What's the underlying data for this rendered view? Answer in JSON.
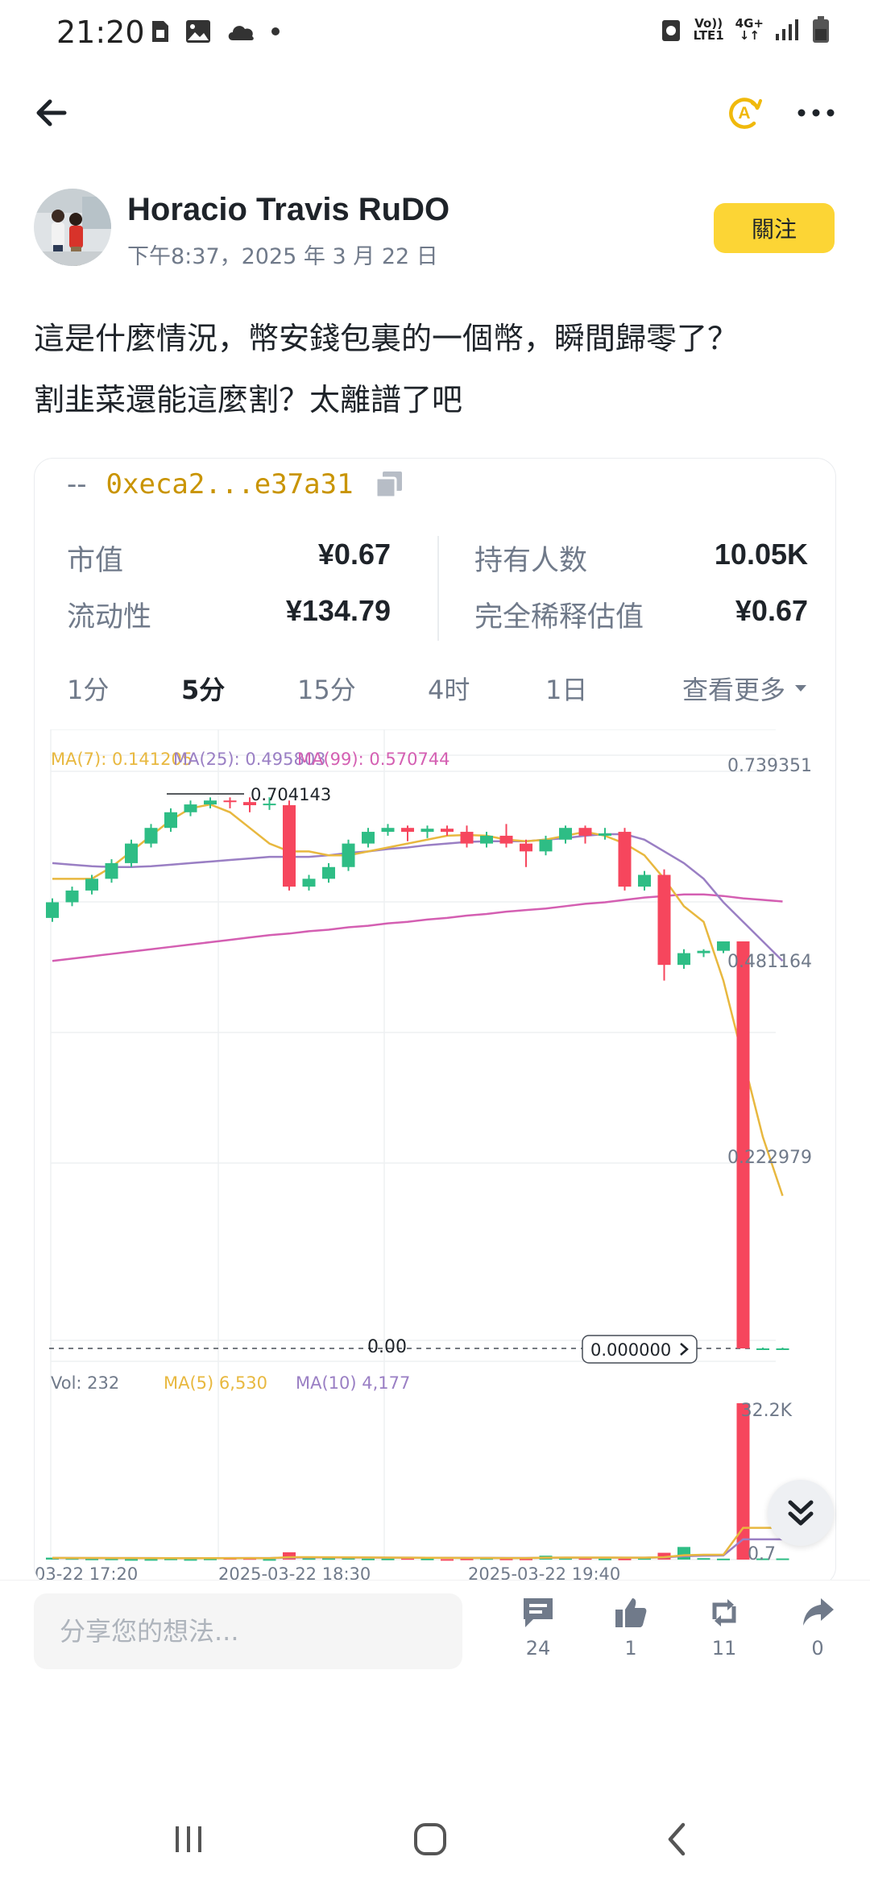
{
  "status": {
    "time": "21:20",
    "net_top": "Vo))",
    "net_bottom": "LTE1",
    "gen_top": "4G+",
    "gen_bottom": "↓↑"
  },
  "post": {
    "author": "Horacio Travis RuDO",
    "time": "下午8:37，2025 年 3 月 22 日",
    "follow_label": "關注",
    "text_line1": "這是什麼情況，幣安錢包裏的一個幣，瞬間歸零了？",
    "text_line2": "割韭菜還能這麼割？太離譜了吧"
  },
  "token": {
    "dash": "--",
    "address": "0xeca2...e37a31",
    "stats": {
      "market_cap_label": "市值",
      "market_cap_value": "¥0.67",
      "liquidity_label": "流动性",
      "liquidity_value": "¥134.79",
      "holders_label": "持有人数",
      "holders_value": "10.05K",
      "fdv_label": "完全稀释估值",
      "fdv_value": "¥0.67"
    },
    "tabs": [
      "1分",
      "5分",
      "15分",
      "4时",
      "1日"
    ],
    "active_tab": "5分",
    "more_label": "查看更多"
  },
  "chart_data": {
    "type": "candlestick",
    "ma_legend": {
      "ma7": "MA(7): 0.141205",
      "ma25": "MA(25): 0.495803",
      "ma99": "MA(99): 0.570744"
    },
    "price_axis_labels": [
      "0.739351",
      "0.481164",
      "0.222979",
      "0.00"
    ],
    "high_marker": "0.704143",
    "current_price": "0.000000",
    "volume_legend": {
      "vol": "Vol: 232",
      "ma5": "MA(5) 6,530",
      "ma10": "MA(10) 4,177"
    },
    "volume_axis_labels": [
      "32.2K",
      "0.7"
    ],
    "time_labels": [
      "03-22 17:20",
      "2025-03-22 18:30",
      "2025-03-22 19:40"
    ],
    "ylim": [
      0,
      0.739351
    ],
    "candles": [
      {
        "o": 0.55,
        "c": 0.57,
        "h": 0.575,
        "l": 0.545
      },
      {
        "o": 0.57,
        "c": 0.585,
        "h": 0.59,
        "l": 0.565
      },
      {
        "o": 0.585,
        "c": 0.6,
        "h": 0.605,
        "l": 0.58
      },
      {
        "o": 0.6,
        "c": 0.62,
        "h": 0.625,
        "l": 0.595
      },
      {
        "o": 0.62,
        "c": 0.645,
        "h": 0.65,
        "l": 0.615
      },
      {
        "o": 0.645,
        "c": 0.665,
        "h": 0.67,
        "l": 0.64
      },
      {
        "o": 0.665,
        "c": 0.685,
        "h": 0.69,
        "l": 0.66
      },
      {
        "o": 0.685,
        "c": 0.695,
        "h": 0.7,
        "l": 0.68
      },
      {
        "o": 0.695,
        "c": 0.7,
        "h": 0.704,
        "l": 0.69
      },
      {
        "o": 0.7,
        "c": 0.698,
        "h": 0.704,
        "l": 0.69
      },
      {
        "o": 0.698,
        "c": 0.694,
        "h": 0.704,
        "l": 0.685
      },
      {
        "o": 0.694,
        "c": 0.696,
        "h": 0.704143,
        "l": 0.688
      },
      {
        "o": 0.694,
        "c": 0.59,
        "h": 0.7,
        "l": 0.585
      },
      {
        "o": 0.59,
        "c": 0.6,
        "h": 0.605,
        "l": 0.585
      },
      {
        "o": 0.6,
        "c": 0.615,
        "h": 0.62,
        "l": 0.595
      },
      {
        "o": 0.615,
        "c": 0.645,
        "h": 0.65,
        "l": 0.61
      },
      {
        "o": 0.645,
        "c": 0.66,
        "h": 0.665,
        "l": 0.64
      },
      {
        "o": 0.66,
        "c": 0.665,
        "h": 0.67,
        "l": 0.655
      },
      {
        "o": 0.665,
        "c": 0.66,
        "h": 0.668,
        "l": 0.648
      },
      {
        "o": 0.66,
        "c": 0.664,
        "h": 0.668,
        "l": 0.652
      },
      {
        "o": 0.664,
        "c": 0.66,
        "h": 0.668,
        "l": 0.655
      },
      {
        "o": 0.66,
        "c": 0.645,
        "h": 0.668,
        "l": 0.64
      },
      {
        "o": 0.645,
        "c": 0.655,
        "h": 0.66,
        "l": 0.64
      },
      {
        "o": 0.655,
        "c": 0.645,
        "h": 0.67,
        "l": 0.64
      },
      {
        "o": 0.645,
        "c": 0.635,
        "h": 0.65,
        "l": 0.615
      },
      {
        "o": 0.635,
        "c": 0.65,
        "h": 0.655,
        "l": 0.63
      },
      {
        "o": 0.65,
        "c": 0.665,
        "h": 0.668,
        "l": 0.645
      },
      {
        "o": 0.665,
        "c": 0.655,
        "h": 0.668,
        "l": 0.645
      },
      {
        "o": 0.655,
        "c": 0.658,
        "h": 0.665,
        "l": 0.65
      },
      {
        "o": 0.66,
        "c": 0.59,
        "h": 0.665,
        "l": 0.585
      },
      {
        "o": 0.59,
        "c": 0.605,
        "h": 0.61,
        "l": 0.585
      },
      {
        "o": 0.605,
        "c": 0.49,
        "h": 0.612,
        "l": 0.47
      },
      {
        "o": 0.49,
        "c": 0.505,
        "h": 0.51,
        "l": 0.485
      },
      {
        "o": 0.505,
        "c": 0.508,
        "h": 0.51,
        "l": 0.5
      },
      {
        "o": 0.508,
        "c": 0.52,
        "h": 0.52,
        "l": 0.505
      },
      {
        "o": 0.52,
        "c": 0.0,
        "h": 0.52,
        "l": 0.0
      },
      {
        "o": 0.0,
        "c": 0.0,
        "h": 0.001,
        "l": 0.0
      },
      {
        "o": 0.0,
        "c": 0.0,
        "h": 0.001,
        "l": 0.0
      }
    ],
    "ma7_line": [
      0.6,
      0.6,
      0.6,
      0.615,
      0.635,
      0.655,
      0.675,
      0.69,
      0.695,
      0.685,
      0.665,
      0.645,
      0.635,
      0.635,
      0.63,
      0.63,
      0.635,
      0.64,
      0.645,
      0.65,
      0.655,
      0.656,
      0.655,
      0.65,
      0.648,
      0.65,
      0.655,
      0.66,
      0.655,
      0.645,
      0.63,
      0.6,
      0.565,
      0.545,
      0.47,
      0.37,
      0.27,
      0.195
    ],
    "ma25_line": [
      0.62,
      0.618,
      0.616,
      0.615,
      0.615,
      0.616,
      0.618,
      0.62,
      0.622,
      0.624,
      0.626,
      0.628,
      0.628,
      0.628,
      0.63,
      0.633,
      0.635,
      0.638,
      0.64,
      0.643,
      0.645,
      0.647,
      0.648,
      0.648,
      0.648,
      0.65,
      0.652,
      0.655,
      0.657,
      0.657,
      0.65,
      0.635,
      0.62,
      0.6,
      0.57,
      0.545,
      0.52,
      0.495
    ],
    "ma99_line": [
      0.495,
      0.498,
      0.501,
      0.504,
      0.507,
      0.51,
      0.513,
      0.516,
      0.519,
      0.522,
      0.525,
      0.528,
      0.53,
      0.533,
      0.535,
      0.538,
      0.54,
      0.543,
      0.545,
      0.548,
      0.55,
      0.553,
      0.555,
      0.558,
      0.56,
      0.562,
      0.565,
      0.568,
      0.57,
      0.573,
      0.576,
      0.578,
      0.58,
      0.58,
      0.578,
      0.575,
      0.573,
      0.571
    ],
    "volumes": [
      400,
      300,
      200,
      200,
      100,
      100,
      200,
      100,
      200,
      400,
      300,
      100,
      1500,
      300,
      300,
      400,
      200,
      200,
      300,
      200,
      100,
      200,
      300,
      200,
      200,
      800,
      300,
      300,
      200,
      200,
      300,
      1400,
      2600,
      300,
      200,
      32200,
      232,
      232
    ],
    "vol_ma5_line": [
      350,
      340,
      330,
      320,
      310,
      300,
      290,
      280,
      290,
      300,
      310,
      300,
      500,
      500,
      480,
      460,
      440,
      420,
      400,
      380,
      360,
      340,
      330,
      320,
      310,
      400,
      420,
      420,
      410,
      400,
      400,
      500,
      900,
      1000,
      1000,
      6530,
      6530,
      6530
    ],
    "vol_ma10_line": [
      330,
      330,
      320,
      320,
      310,
      310,
      300,
      300,
      300,
      310,
      320,
      320,
      420,
      430,
      430,
      420,
      410,
      400,
      390,
      380,
      370,
      360,
      350,
      340,
      330,
      380,
      390,
      400,
      400,
      400,
      400,
      450,
      700,
      800,
      850,
      4177,
      4177,
      4177
    ],
    "vol_ylim": [
      0,
      32200
    ]
  },
  "actions": {
    "comment_placeholder": "分享您的想法...",
    "comments": "24",
    "likes": "1",
    "reposts": "11",
    "shares": "0"
  },
  "colors": {
    "up": "#2ebd85",
    "down": "#f6465d",
    "accent": "#fcd535",
    "ma7": "#e8b83f",
    "ma25": "#9a7fc4",
    "ma99": "#d45fb2"
  }
}
